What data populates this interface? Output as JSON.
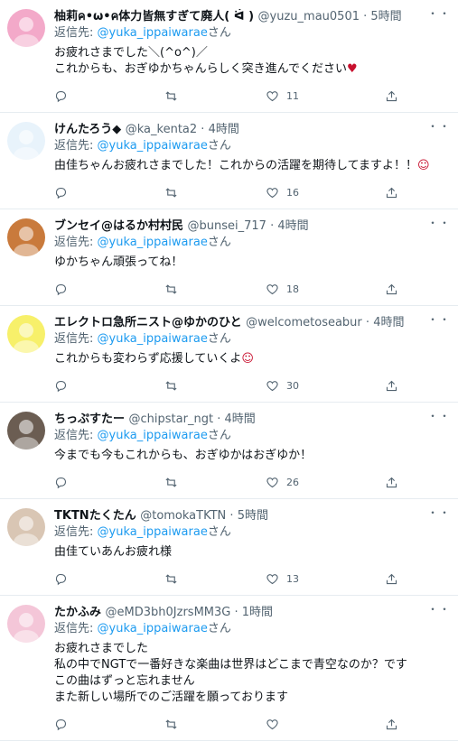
{
  "reply_prefix": "返信先: ",
  "more_glyph": "・・",
  "tweets": [
    {
      "name": "柚莉ค•ω•ค体力皆無すぎて廃人( ᐛ ) ",
      "handle": "@yuzu_mau0501",
      "dot": " · ",
      "time": "5時間",
      "reply_to": "@yuka_ippaiwarae",
      "reply_suffix": "さん",
      "text": "お疲れさまでした＼(^o^)／\nこれからも、おぎゆかちゃんらしく突き進んでください",
      "emoji": "♥",
      "likes": "11",
      "avatar_color": "#f3a9c9"
    },
    {
      "name": "けんたろう◆ ",
      "handle": "@ka_kenta2",
      "dot": " · ",
      "time": "4時間",
      "reply_to": "@yuka_ippaiwarae",
      "reply_suffix": "さん",
      "text": "由佳ちゃんお疲れさまでした！これからの活躍を期待してますよ！！",
      "emoji": "☺",
      "likes": "16",
      "avatar_color": "#e8f3fb"
    },
    {
      "name": "ブンセイ@はるか村村民 ",
      "handle": "@bunsei_717",
      "dot": " · ",
      "time": "4時間",
      "reply_to": "@yuka_ippaiwarae",
      "reply_suffix": "さん",
      "text": "ゆかちゃん頑張ってね！",
      "emoji": "",
      "likes": "18",
      "avatar_color": "#c97a3c"
    },
    {
      "name": "エレクトロ急所ニスト@ゆかのひと ",
      "handle": "@welcometoseabur",
      "dot": " · ",
      "time": "4時間",
      "reply_to": "@yuka_ippaiwarae",
      "reply_suffix": "さん",
      "text": "これからも変わらず応援していくよ",
      "emoji": "☺",
      "likes": "30",
      "avatar_color": "#f7f06a"
    },
    {
      "name": "ちっぷすたー ",
      "handle": "@chipstar_ngt",
      "dot": " · ",
      "time": "4時間",
      "reply_to": "@yuka_ippaiwarae",
      "reply_suffix": "さん",
      "text": "今までも今もこれからも、おぎゆかはおぎゆか！",
      "emoji": "",
      "likes": "26",
      "avatar_color": "#6b5d52"
    },
    {
      "name": "TKTNたくたん ",
      "handle": "@tomokaTKTN",
      "dot": " · ",
      "time": "5時間",
      "reply_to": "@yuka_ippaiwarae",
      "reply_suffix": "さん",
      "text": "由佳ていあんお疲れ様",
      "emoji": "",
      "likes": "13",
      "avatar_color": "#d9c6b4"
    },
    {
      "name": "たかふみ ",
      "handle": "@eMD3bh0JzrsMM3G",
      "dot": " · ",
      "time": "1時間",
      "reply_to": "@yuka_ippaiwarae",
      "reply_suffix": "さん",
      "text": "お疲れさまでした\n私の中でNGTで一番好きな楽曲は世界はどこまで青空なのか？です\nこの曲はずっと忘れません\nまた新しい場所でのご活躍を願っております",
      "emoji": "",
      "likes": "",
      "avatar_color": "#f4c6d8"
    }
  ]
}
